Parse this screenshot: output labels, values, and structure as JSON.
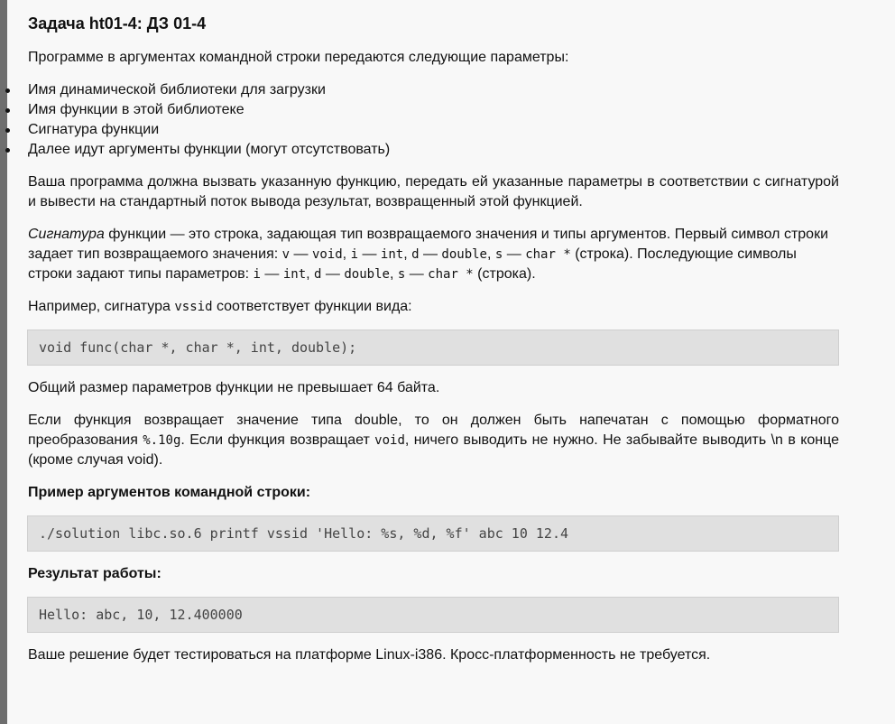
{
  "title": "Задача ht01-4: ДЗ 01-4",
  "intro": "Программе в аргументах командной строки передаются следующие параметры:",
  "list": [
    "Имя динамической библиотеки для загрузки",
    "Имя функции в этой библиотеке",
    "Сигнатура функции",
    "Далее идут аргументы функции (могут отсутствовать)"
  ],
  "p_task": "Ваша программа должна вызвать указанную функцию, передать ей указанные параметры в соответствии с сигнатурой и вывести на стандартный поток вывода результат, возвращенный этой функцией.",
  "sig": {
    "em": "Сигнатура",
    "t1": " функции — это строка, задающая тип возвращаемого значения и типы аргументов. Первый символ строки задает тип возвращаемого значения: ",
    "c1": "v",
    "t2": " — ",
    "c2": "void",
    "t3": ", ",
    "c3": "i",
    "t4": " — ",
    "c4": "int",
    "t5": ", ",
    "c5": "d",
    "t6": " — ",
    "c6": "double",
    "t7": ", ",
    "c7": "s",
    "t8": " — ",
    "c8": "char *",
    "t9": " (строка). Последующие символы строки задают типы параметров: ",
    "c9": "i",
    "t10": " — ",
    "c10": "int",
    "t11": ", ",
    "c11": "d",
    "t12": " — ",
    "c12": "double",
    "t13": ", ",
    "c13": "s",
    "t14": " — ",
    "c14": "char *",
    "t15": " (строка)."
  },
  "example": {
    "t1": "Например, сигнатура ",
    "c1": "vssid",
    "t2": " соответствует функции вида:"
  },
  "code1": "void func(char *, char *, int, double);",
  "p_size": "Общий размер параметров функции не превышает 64 байта.",
  "p_double": {
    "t1": "Если функция возвращает значение типа double, то он должен быть напечатан с помощью форматного преобразования ",
    "c1": "%.10g",
    "t2": ". Если функция возвращает ",
    "c2": "void",
    "t3": ", ничего выводить не нужно. Не забывайте выводить \\n в конце (кроме случая void)."
  },
  "h_args": "Пример аргументов командной строки:",
  "code2": "./solution libc.so.6 printf vssid 'Hello: %s, %d, %f' abc 10 12.4",
  "h_result": "Результат работы:",
  "code3": "Hello: abc, 10, 12.400000",
  "p_platform": "Ваше решение будет тестироваться на платформе Linux-i386. Кросс-платформенность не требуется."
}
